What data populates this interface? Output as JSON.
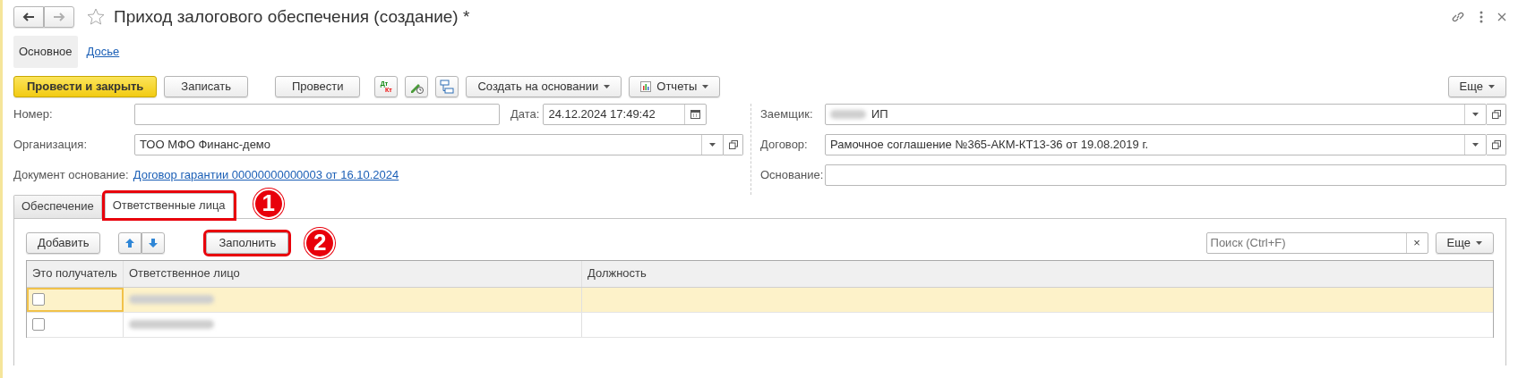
{
  "window": {
    "title": "Приход залогового обеспечения (создание) *",
    "favorite": false
  },
  "nav_buttons": [
    {
      "kind": "back",
      "disabled": false
    },
    {
      "kind": "forward",
      "disabled": true
    }
  ],
  "sections": [
    {
      "label": "Основное",
      "selected": true
    },
    {
      "label": "Досье",
      "selected": false
    }
  ],
  "toolbar": [
    {
      "kind": "primary",
      "label": "Провести и закрыть"
    },
    {
      "kind": "button",
      "label": "Записать"
    },
    {
      "kind": "button",
      "label": "Провести"
    },
    {
      "kind": "dtkt",
      "top": "Дт",
      "bottom": "Кт"
    },
    {
      "kind": "pen"
    },
    {
      "kind": "structure"
    },
    {
      "kind": "dropdown",
      "label": "Создать на основании"
    },
    {
      "kind": "reports",
      "label": "Отчеты"
    }
  ],
  "more_button": {
    "label": "Еще"
  },
  "left_fields": [
    {
      "kind": "number",
      "label": "Номер:",
      "date_label": "Дата:",
      "date_value": "24.12.2024 17:49:42"
    },
    {
      "kind": "select",
      "label": "Организация:",
      "value": "ТОО МФО Финанс-демо"
    },
    {
      "kind": "link",
      "label": "Документ основание:",
      "value": "Договор гарантии 00000000000003 от 16.10.2024"
    }
  ],
  "right_fields": [
    {
      "kind": "select",
      "label": "Заемщик:",
      "value": "ИП",
      "redacted_prefix": true
    },
    {
      "kind": "select",
      "label": "Договор:",
      "value": "Рамочное соглашение №365-АКМ-КТ13-36 от 19.08.2019 г."
    },
    {
      "kind": "text",
      "label": "Основание:"
    }
  ],
  "tabs": [
    {
      "label": "Обеспечение",
      "selected": false
    },
    {
      "label": "Ответственные лица",
      "selected": true,
      "callout": "1"
    }
  ],
  "table_toolbar": {
    "add": {
      "label": "Добавить"
    },
    "fill": {
      "label": "Заполнить",
      "callout": "2"
    },
    "search": {
      "placeholder": "Поиск (Ctrl+F)",
      "clear": "×"
    },
    "more": {
      "label": "Еще"
    }
  },
  "table": {
    "columns": [
      "Это получатель",
      "Ответственное лицо",
      "Должность"
    ],
    "rows": [
      {
        "checked": false,
        "selected": true,
        "person_redacted": true
      },
      {
        "checked": false,
        "selected": false,
        "person_redacted": true
      }
    ]
  }
}
